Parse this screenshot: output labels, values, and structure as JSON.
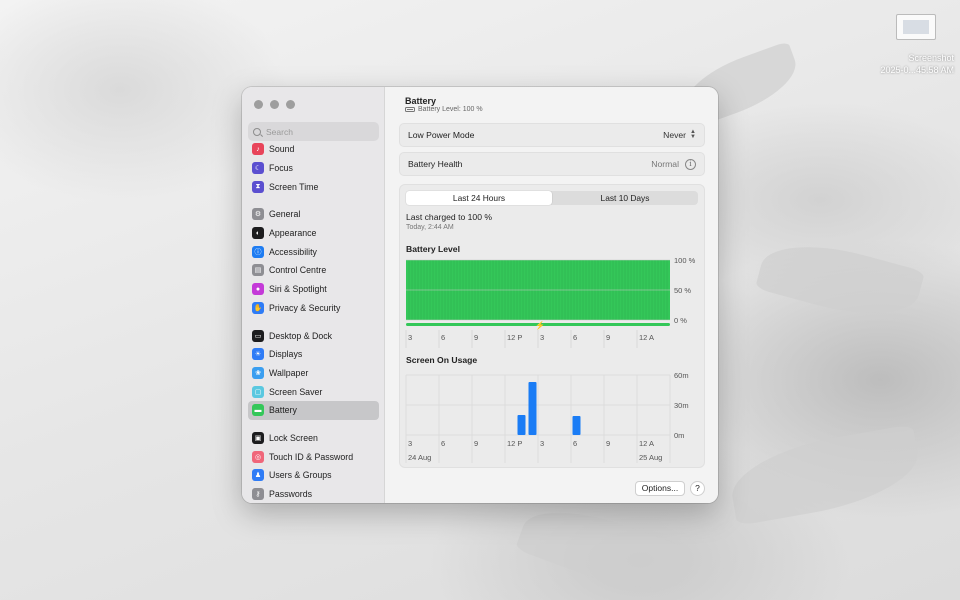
{
  "desktop": {
    "file_icon": "screenshot-file-icon",
    "file_label_line1": "Screenshot",
    "file_label_line2": "2025-0...45.58 AM"
  },
  "sidebar": {
    "search_placeholder": "Search",
    "groups": [
      [
        {
          "label": "Sound",
          "icon": "speaker-icon",
          "color": "#e8445a"
        },
        {
          "label": "Focus",
          "icon": "moon-icon",
          "color": "#5b4fd0"
        },
        {
          "label": "Screen Time",
          "icon": "hourglass-icon",
          "color": "#5b4fd0"
        }
      ],
      [
        {
          "label": "General",
          "icon": "gear-icon",
          "color": "#8e8e93"
        },
        {
          "label": "Appearance",
          "icon": "appearance-icon",
          "color": "#1c1c1e"
        },
        {
          "label": "Accessibility",
          "icon": "accessibility-icon",
          "color": "#1e7cf2"
        },
        {
          "label": "Control Centre",
          "icon": "control-centre-icon",
          "color": "#8e8e93"
        },
        {
          "label": "Siri & Spotlight",
          "icon": "siri-icon",
          "color": "#c43ad8"
        },
        {
          "label": "Privacy & Security",
          "icon": "hand-icon",
          "color": "#2f7cf6"
        }
      ],
      [
        {
          "label": "Desktop & Dock",
          "icon": "dock-icon",
          "color": "#1c1c1e"
        },
        {
          "label": "Displays",
          "icon": "sun-icon",
          "color": "#2f7cf6"
        },
        {
          "label": "Wallpaper",
          "icon": "wallpaper-icon",
          "color": "#3a9ef0"
        },
        {
          "label": "Screen Saver",
          "icon": "screen-saver-icon",
          "color": "#5ac8e0"
        },
        {
          "label": "Battery",
          "icon": "battery-icon",
          "color": "#34c759",
          "selected": true
        }
      ],
      [
        {
          "label": "Lock Screen",
          "icon": "lock-icon",
          "color": "#1c1c1e"
        },
        {
          "label": "Touch ID & Password",
          "icon": "fingerprint-icon",
          "color": "#f0667a"
        },
        {
          "label": "Users & Groups",
          "icon": "users-icon",
          "color": "#2f7cf6"
        },
        {
          "label": "Passwords",
          "icon": "key-icon",
          "color": "#8e8e93"
        }
      ]
    ]
  },
  "header": {
    "title": "Battery",
    "subtitle": "Battery Level: 100 %"
  },
  "low_power": {
    "label": "Low Power Mode",
    "value": "Never"
  },
  "health": {
    "label": "Battery Health",
    "value": "Normal"
  },
  "tabs": {
    "left": "Last 24 Hours",
    "right": "Last 10 Days",
    "selected": "left"
  },
  "charge": {
    "text": "Last charged to 100 %",
    "time": "Today, 2:44 AM"
  },
  "battery_chart": {
    "title": "Battery Level",
    "y_ticks": [
      "100 %",
      "50 %",
      "0 %"
    ],
    "x_ticks": [
      "3",
      "6",
      "9",
      "12 P",
      "3",
      "6",
      "9",
      "12 A"
    ],
    "level_pct": 100,
    "charging_marker": "lightning-icon"
  },
  "usage_chart": {
    "title": "Screen On Usage",
    "y_ticks": [
      "60m",
      "30m",
      "0m"
    ],
    "x_ticks": [
      "3",
      "6",
      "9",
      "12 P",
      "3",
      "6",
      "9",
      "12 A"
    ],
    "date_left": "24 Aug",
    "date_right": "25 Aug"
  },
  "chart_data": [
    {
      "type": "area",
      "title": "Battery Level",
      "ylabel": "",
      "ylim": [
        0,
        100
      ],
      "categories": [
        "3",
        "6",
        "9",
        "12 P",
        "3",
        "6",
        "9",
        "12 A"
      ],
      "values": [
        100,
        100,
        100,
        100,
        100,
        100,
        100,
        100
      ]
    },
    {
      "type": "bar",
      "title": "Screen On Usage",
      "ylim": [
        0,
        60
      ],
      "unit": "m",
      "bars": [
        {
          "hour_after_start": 10,
          "minutes": 20
        },
        {
          "hour_after_start": 11,
          "minutes": 53
        },
        {
          "hour_after_start": 15,
          "minutes": 19
        }
      ]
    }
  ],
  "footer": {
    "options": "Options...",
    "help": "?"
  }
}
